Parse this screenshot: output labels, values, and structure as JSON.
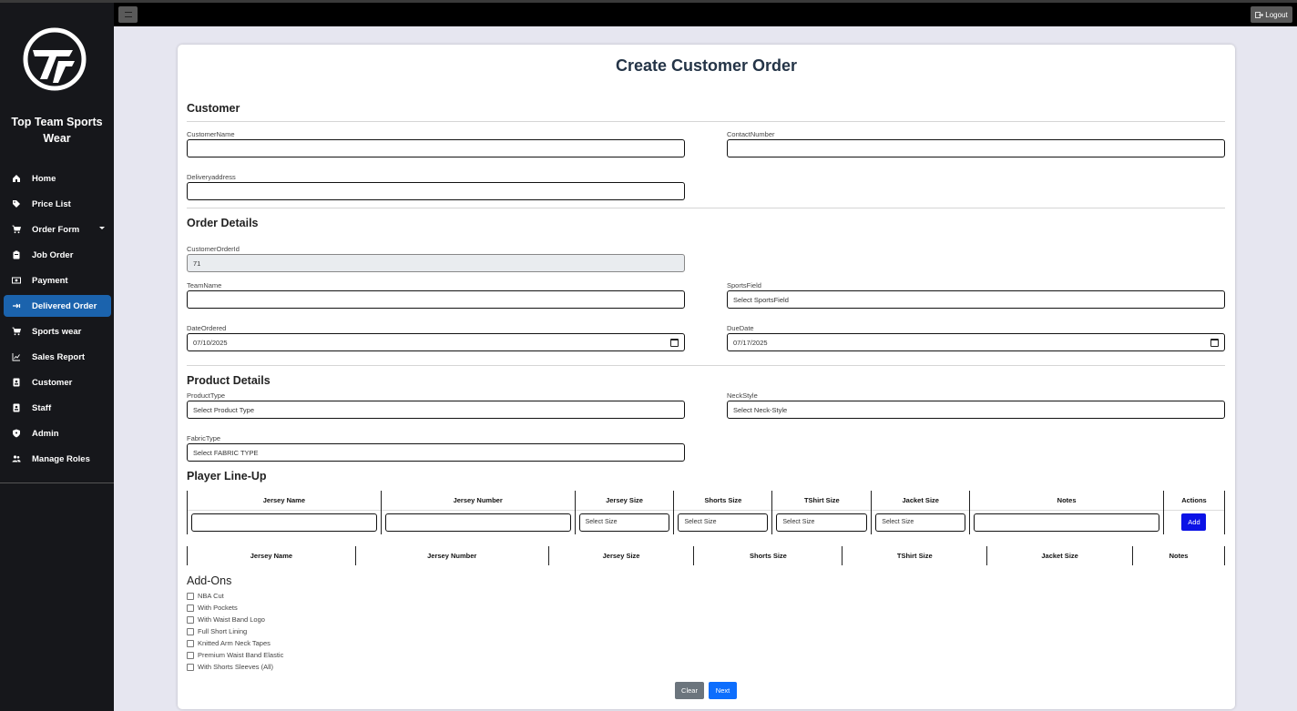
{
  "sidebar": {
    "brand": "Top Team Sports Wear",
    "items": [
      {
        "label": "Home",
        "icon": "home-icon"
      },
      {
        "label": "Price List",
        "icon": "tag-icon"
      },
      {
        "label": "Order Form",
        "icon": "cart-icon",
        "has_caret": true
      },
      {
        "label": "Job Order",
        "icon": "clipboard-icon"
      },
      {
        "label": "Payment",
        "icon": "money-icon"
      },
      {
        "label": "Delivered Order",
        "icon": "delivery-icon",
        "active": true
      },
      {
        "label": "Sports wear",
        "icon": "cart-icon"
      },
      {
        "label": "Sales Report",
        "icon": "chart-line-icon"
      },
      {
        "label": "Customer",
        "icon": "id-badge-icon"
      },
      {
        "label": "Staff",
        "icon": "id-badge-icon"
      },
      {
        "label": "Admin",
        "icon": "shield-icon"
      },
      {
        "label": "Manage Roles",
        "icon": "users-icon"
      }
    ]
  },
  "topbar": {
    "logout_label": "Logout"
  },
  "form": {
    "title": "Create Customer Order",
    "customer": {
      "heading": "Customer",
      "name_label": "CustomerName",
      "name_value": "",
      "contact_label": "ContactNumber",
      "contact_value": "",
      "address_label": "Deliveryaddress",
      "address_value": ""
    },
    "order": {
      "heading": "Order Details",
      "id_label": "CustomerOrderId",
      "id_value": "71",
      "team_label": "TeamName",
      "team_value": "",
      "sports_label": "SportsField",
      "sports_value": "Select SportsField",
      "date_ordered_label": "DateOrdered",
      "date_ordered_value": "07/10/2025",
      "due_label": "DueDate",
      "due_value": "07/17/2025"
    },
    "product": {
      "heading": "Product Details",
      "type_label": "ProductType",
      "type_value": "Select Product Type",
      "neck_label": "NeckStyle",
      "neck_value": "Select Neck-Style",
      "fabric_label": "FabricType",
      "fabric_value": "Select FABRIC TYPE"
    },
    "lineup": {
      "heading": "Player Line-Up",
      "entry_headers": [
        "Jersey Name",
        "Jersey Number",
        "Jersey Size",
        "Shorts Size",
        "TShirt Size",
        "Jacket Size",
        "Notes",
        "Actions"
      ],
      "size_placeholder": "Select Size",
      "add_label": "Add",
      "list_headers": [
        "Jersey Name",
        "Jersey Number",
        "Jersey Size",
        "Shorts Size",
        "TShirt Size",
        "Jacket Size",
        "Notes"
      ]
    },
    "addons": {
      "heading": "Add-Ons",
      "items": [
        "NBA Cut",
        "With Pockets",
        "With Waist Band Logo",
        "Full Short Lining",
        "Knitted Arm Neck Tapes",
        "Premium Waist Band Elastic",
        "With Shorts Sleeves (All)"
      ]
    },
    "clear_label": "Clear",
    "next_label": "Next"
  },
  "colors": {
    "sidebar_bg": "#16171b",
    "active": "#1b63ad",
    "add_button": "#0b12e6",
    "next_button": "#0d6efd",
    "clear_button": "#6c757d"
  }
}
